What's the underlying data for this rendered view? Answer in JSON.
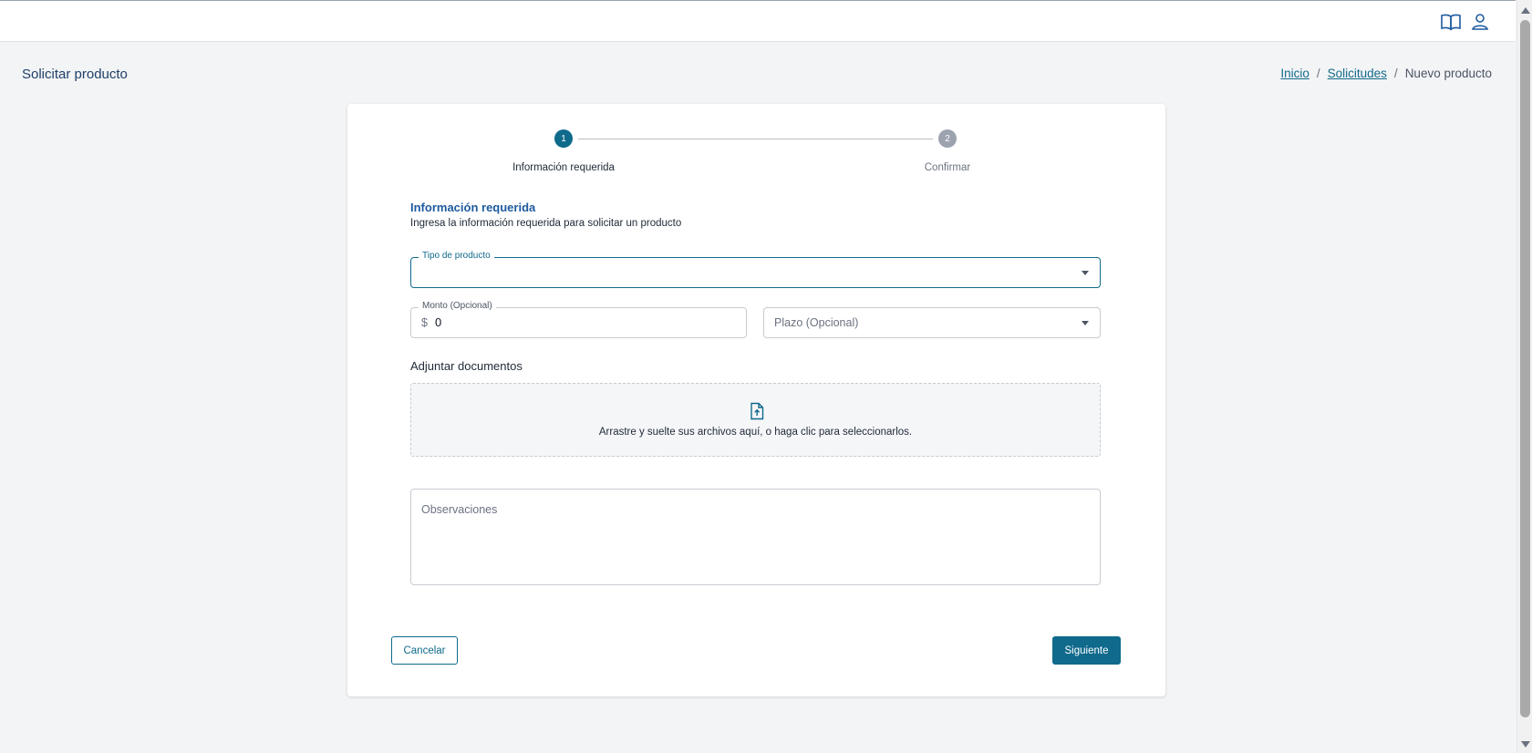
{
  "topbar": {
    "icons": [
      "book-icon",
      "user-icon"
    ]
  },
  "page": {
    "title": "Solicitar producto"
  },
  "breadcrumb": {
    "items": [
      "Inicio",
      "Solicitudes",
      "Nuevo producto"
    ],
    "separator": "/"
  },
  "stepper": {
    "steps": [
      {
        "number": "1",
        "label": "Información requerida"
      },
      {
        "number": "2",
        "label": "Confirmar"
      }
    ],
    "active_step": 1
  },
  "form": {
    "section_title": "Información requerida",
    "section_subtitle": "Ingresa la información requerida para solicitar un producto",
    "tipo_producto": {
      "label": "Tipo de producto",
      "value": ""
    },
    "monto": {
      "label": "Monto (Opcional)",
      "prefix": "$",
      "value": "0"
    },
    "plazo": {
      "placeholder": "Plazo (Opcional)"
    },
    "attach": {
      "label": "Adjuntar documentos",
      "dropzone_text": "Arrastre y suelte sus archivos aquí, o haga clic para seleccionarlos."
    },
    "observaciones": {
      "placeholder": "Observaciones"
    }
  },
  "actions": {
    "cancel_label": "Cancelar",
    "next_label": "Siguiente"
  },
  "colors": {
    "primary": "#0f6a8c",
    "title_blue": "#1d5a9e",
    "inactive_step": "#9ca3af"
  }
}
